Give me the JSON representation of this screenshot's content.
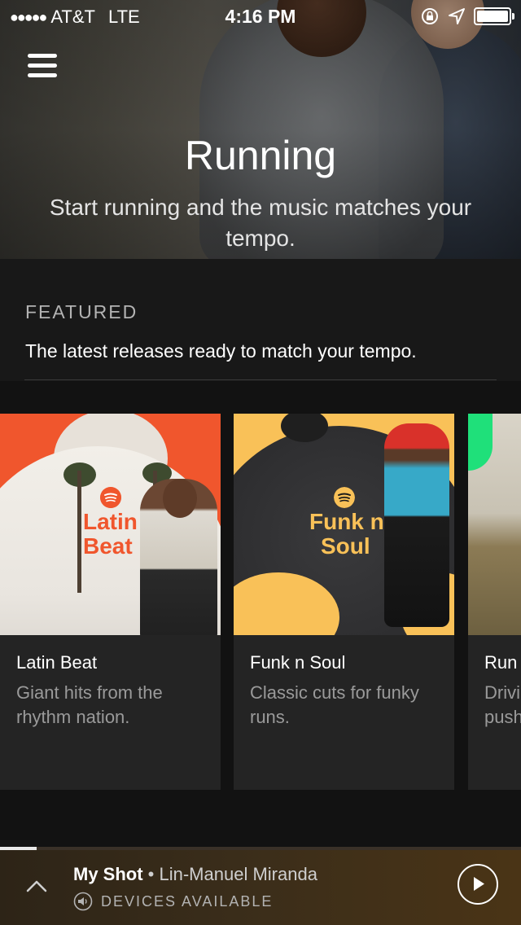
{
  "status_bar": {
    "signal": "●●●●●",
    "carrier": "AT&T",
    "network": "LTE",
    "time": "4:16 PM"
  },
  "hero": {
    "title": "Running",
    "subtitle": "Start running and the music matches your tempo."
  },
  "featured": {
    "label": "FEATURED",
    "description": "The latest releases ready to match your tempo."
  },
  "playlists": [
    {
      "title": "Latin Beat",
      "description": "Giant hits from the rhythm nation.",
      "art_label_line1": "Latin",
      "art_label_line2": "Beat",
      "art_color": "#f0562d"
    },
    {
      "title": "Funk n Soul",
      "description": "Classic cuts for funky runs.",
      "art_label_line1": "Funk n",
      "art_label_line2": "Soul",
      "art_color": "#f9c158"
    },
    {
      "title": "Run",
      "description": "Drivi push",
      "art_color": "#1fe07a"
    }
  ],
  "player": {
    "song": "My Shot",
    "separator": " • ",
    "artist": "Lin-Manuel Miranda",
    "devices": "DEVICES AVAILABLE",
    "progress": 0.07
  }
}
